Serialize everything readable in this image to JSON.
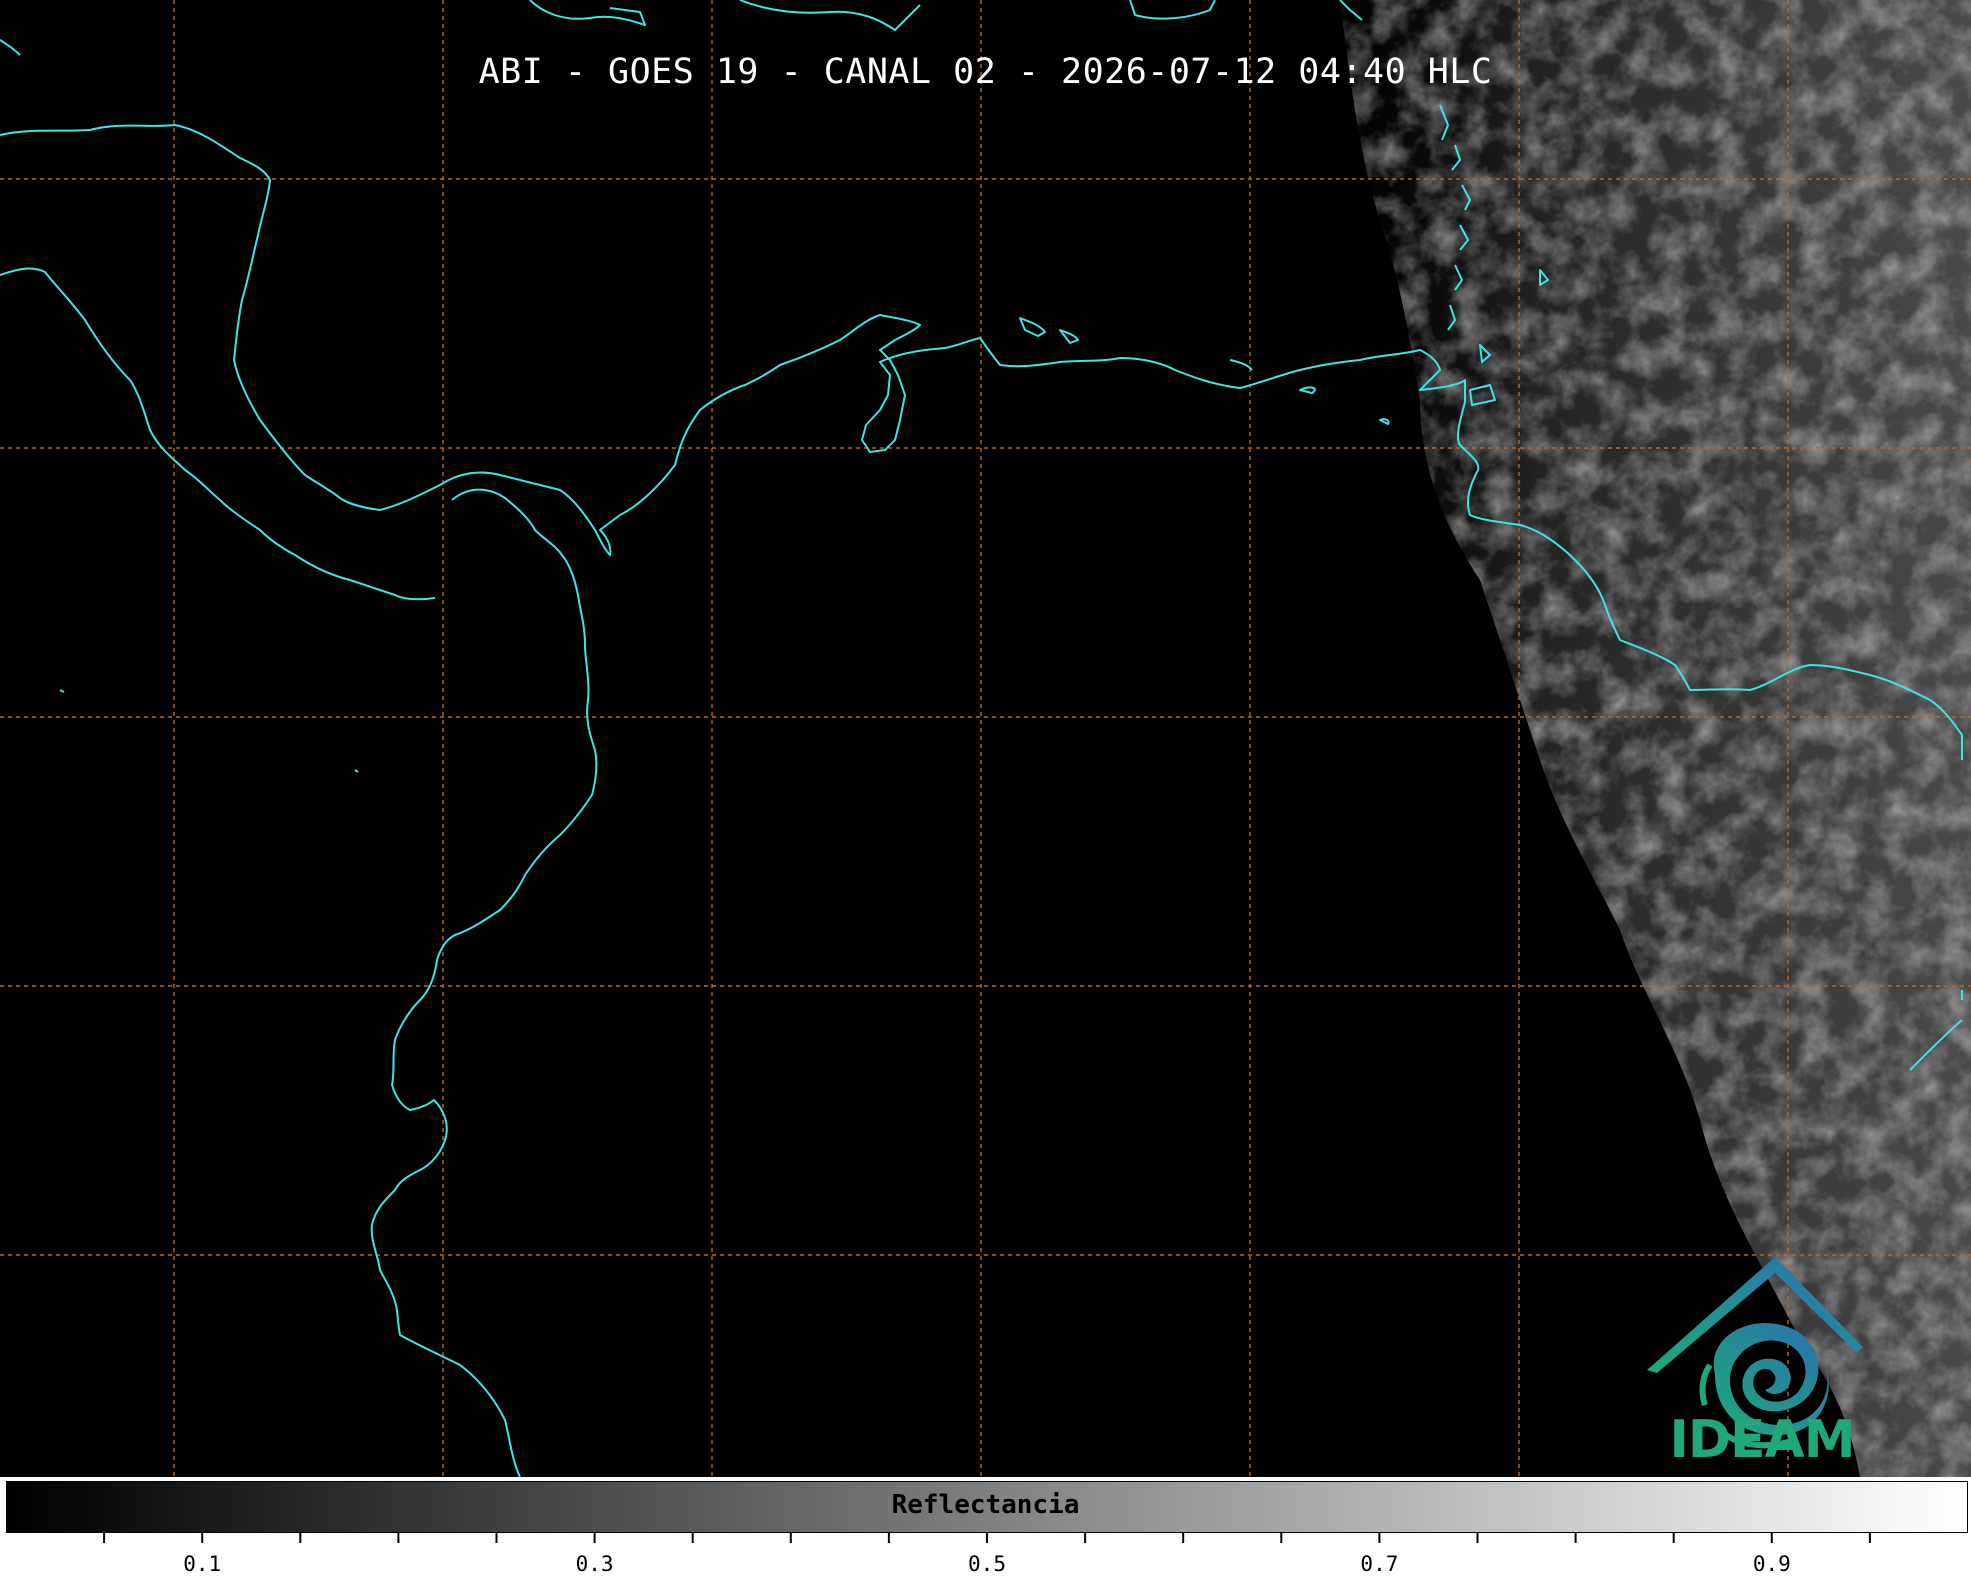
{
  "title": "ABI - GOES 19 - CANAL 02 - 2026-07-12 04:40 HLC",
  "logo": {
    "name": "IDEAM",
    "icon": "ideam-swirl-logo-icon"
  },
  "colorbar": {
    "label": "Reflectancia",
    "min": 0.0,
    "max": 1.0,
    "tick_labels": [
      "0.1",
      "0.3",
      "0.5",
      "0.7",
      "0.9"
    ],
    "major_ticks": [
      0.1,
      0.3,
      0.5,
      0.7,
      0.9
    ],
    "minor_step": 0.05,
    "gradient": [
      "#000000",
      "#ffffff"
    ]
  },
  "colors": {
    "coastline": "#3fe3e0",
    "gridline": "#b8662a",
    "background": "#000000",
    "cloud": "#6a6a6a"
  }
}
